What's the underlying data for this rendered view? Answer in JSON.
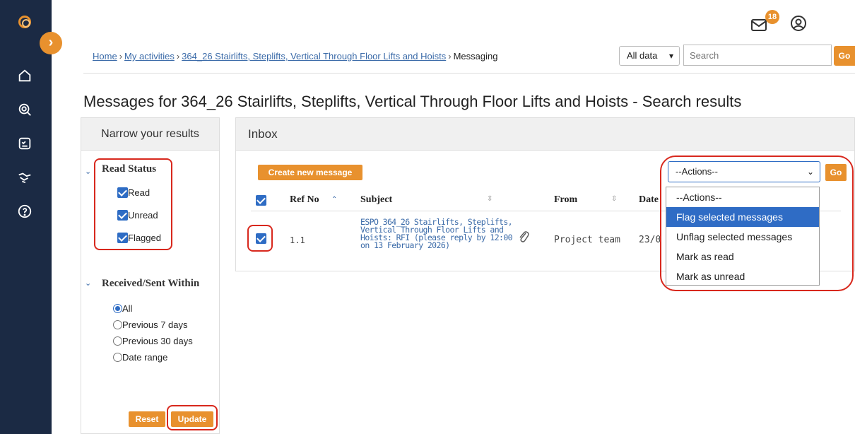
{
  "header": {
    "mail_badge_count": "18"
  },
  "breadcrumb": {
    "items": [
      "Home",
      "My activities",
      "364_26 Stairlifts, Steplifts, Vertical Through Floor Lifts and Hoists"
    ],
    "current": "Messaging",
    "separator": "›"
  },
  "search": {
    "scope_value": "All data",
    "placeholder": "Search",
    "go_label": "Go"
  },
  "page": {
    "title": "Messages for 364_26 Stairlifts, Steplifts, Vertical Through Floor Lifts and Hoists - Search results"
  },
  "filters": {
    "header": "Narrow your results",
    "read_status": {
      "title": "Read Status",
      "options": [
        {
          "label": "Read",
          "checked": true
        },
        {
          "label": "Unread",
          "checked": true
        },
        {
          "label": "Flagged",
          "checked": true
        }
      ]
    },
    "received_within": {
      "title": "Received/Sent Within",
      "options": [
        {
          "label": "All",
          "selected": true
        },
        {
          "label": "Previous 7 days",
          "selected": false
        },
        {
          "label": "Previous 30 days",
          "selected": false
        },
        {
          "label": "Date range",
          "selected": false
        }
      ]
    },
    "reset_label": "Reset",
    "update_label": "Update"
  },
  "inbox": {
    "header": "Inbox",
    "create_label": "Create new message",
    "actions": {
      "selected": "--Actions--",
      "go_label": "Go",
      "options": [
        "--Actions--",
        "Flag selected messages",
        "Unflag selected messages",
        "Mark as read",
        "Mark as unread"
      ],
      "highlighted": "Flag selected messages"
    },
    "columns": [
      "Ref No",
      "Subject",
      "From",
      "Date"
    ],
    "rows": [
      {
        "ref": "1.1",
        "subject": "ESPO 364_26 Stairlifts, Steplifts, Vertical Through Floor Lifts and Hoists: RFI (please reply by 12:00 on 13 February 2026)",
        "from": "Project team",
        "date": "23/0",
        "checked": true,
        "has_attachment": true
      }
    ]
  },
  "colors": {
    "sidebar": "#1b2a44",
    "accent": "#e8912e",
    "link": "#3a6aa8",
    "highlight": "#2f6cc5",
    "annotation": "#d8281d"
  }
}
